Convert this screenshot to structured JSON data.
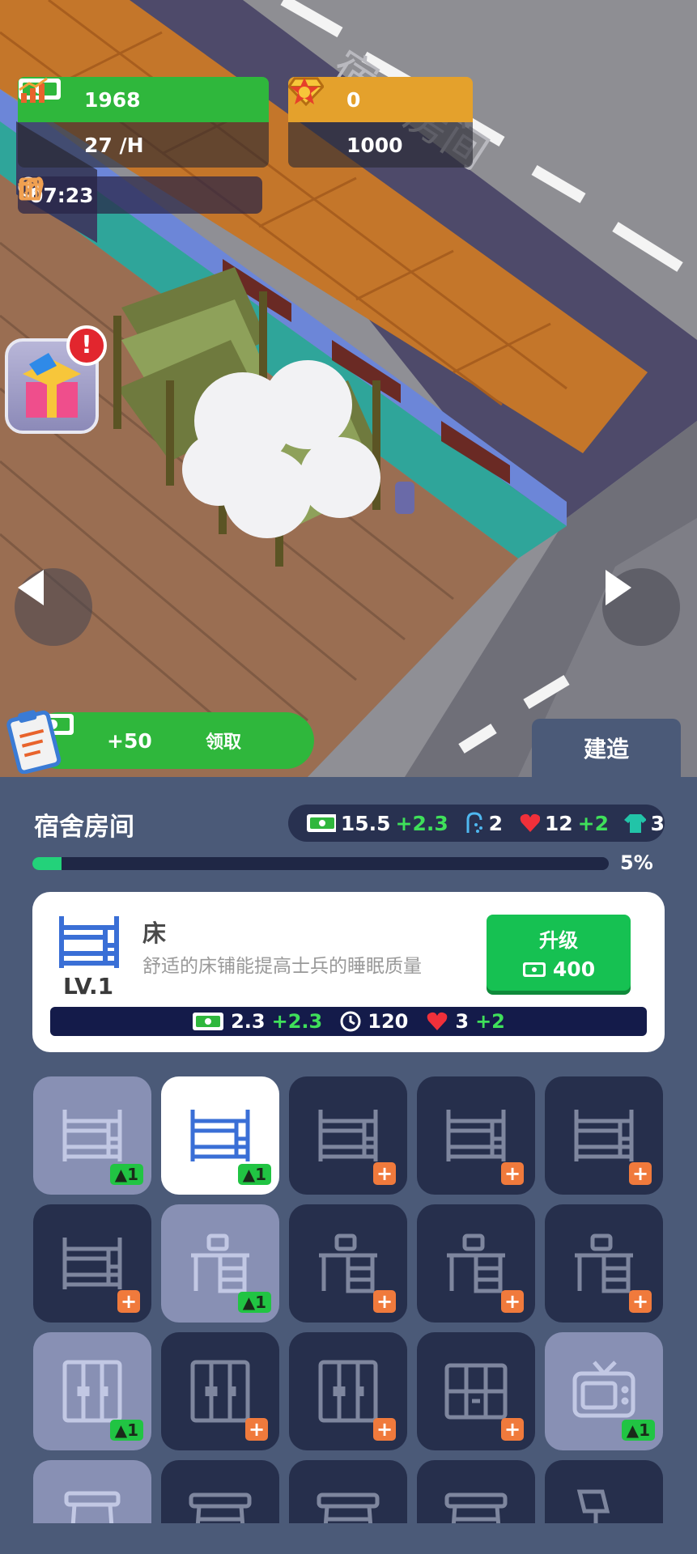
{
  "scene": {
    "floor_sign": "宿舍房间"
  },
  "hud": {
    "money": "1968",
    "income": "27 /H",
    "gems": "0",
    "medals": "1000",
    "time": "07:23"
  },
  "reward": {
    "amount": "+50",
    "claim_label": "领取"
  },
  "build_tab_label": "建造",
  "room": {
    "title": "宿舍房间",
    "stats": {
      "money": "15.5",
      "money_bonus": "+2.3",
      "shower": "2",
      "heart": "12",
      "heart_bonus": "+2",
      "shirt": "3"
    },
    "progress_label": "5%",
    "progress_value": 0.05
  },
  "selected_item": {
    "name": "床",
    "description": "舒适的床铺能提高士兵的睡眠质量",
    "level": "LV.1",
    "upgrade_label": "升级",
    "upgrade_cost": "400",
    "bar": {
      "money": "2.3",
      "money_bonus": "+2.3",
      "time": "120",
      "heart": "3",
      "heart_bonus": "+2"
    }
  },
  "items": [
    {
      "icon": "bunk-bed-icon",
      "state": "owned",
      "badge": "1"
    },
    {
      "icon": "bunk-bed-icon",
      "state": "selected",
      "badge": "1"
    },
    {
      "icon": "bunk-bed-icon",
      "state": "locked",
      "badge": "+"
    },
    {
      "icon": "bunk-bed-icon",
      "state": "locked",
      "badge": "+"
    },
    {
      "icon": "bunk-bed-icon",
      "state": "locked",
      "badge": "+"
    },
    {
      "icon": "bunk-bed-icon",
      "state": "locked",
      "badge": "+"
    },
    {
      "icon": "desk-icon",
      "state": "owned",
      "badge": "1"
    },
    {
      "icon": "desk-icon",
      "state": "locked",
      "badge": "+"
    },
    {
      "icon": "desk-icon",
      "state": "locked",
      "badge": "+"
    },
    {
      "icon": "desk-icon",
      "state": "locked",
      "badge": "+"
    },
    {
      "icon": "wardrobe-icon",
      "state": "owned",
      "badge": "1"
    },
    {
      "icon": "wardrobe-icon",
      "state": "locked",
      "badge": "+"
    },
    {
      "icon": "wardrobe-icon",
      "state": "locked",
      "badge": "+"
    },
    {
      "icon": "cabinet-icon",
      "state": "locked",
      "badge": "+"
    },
    {
      "icon": "tv-icon",
      "state": "owned",
      "badge": "1"
    },
    {
      "icon": "stool-icon",
      "state": "owned",
      "badge": ""
    },
    {
      "icon": "table-icon",
      "state": "locked",
      "badge": ""
    },
    {
      "icon": "table-icon",
      "state": "locked",
      "badge": ""
    },
    {
      "icon": "table-icon",
      "state": "locked",
      "badge": ""
    },
    {
      "icon": "lamp-icon",
      "state": "locked",
      "badge": ""
    }
  ]
}
